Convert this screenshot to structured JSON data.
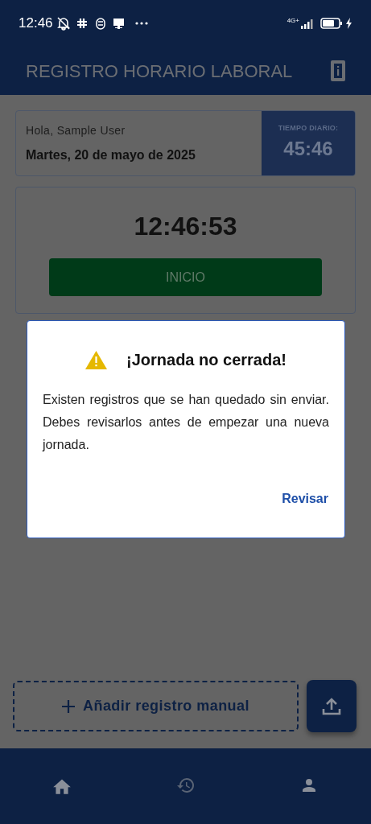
{
  "status_bar": {
    "time": "12:46",
    "network": "4G+"
  },
  "app_bar": {
    "title": "REGISTRO HORARIO LABORAL"
  },
  "greeting_card": {
    "greeting": "Hola, Sample User",
    "date": "Martes, 20 de mayo de 2025",
    "daily_time_label": "TIEMPO DIARIO:",
    "daily_time": "45:46"
  },
  "clock_card": {
    "time": "12:46:53",
    "button": "INICIO"
  },
  "dialog": {
    "title": "¡Jornada no cerrada!",
    "message": "Existen registros que se han quedado sin enviar. Debes revisarlos antes de empezar una nueva jornada.",
    "action": "Revisar"
  },
  "add_button": {
    "label": "Añadir registro manual"
  },
  "bottom_nav": [
    {
      "kind": "home"
    },
    {
      "kind": "history"
    },
    {
      "kind": "profile"
    }
  ]
}
